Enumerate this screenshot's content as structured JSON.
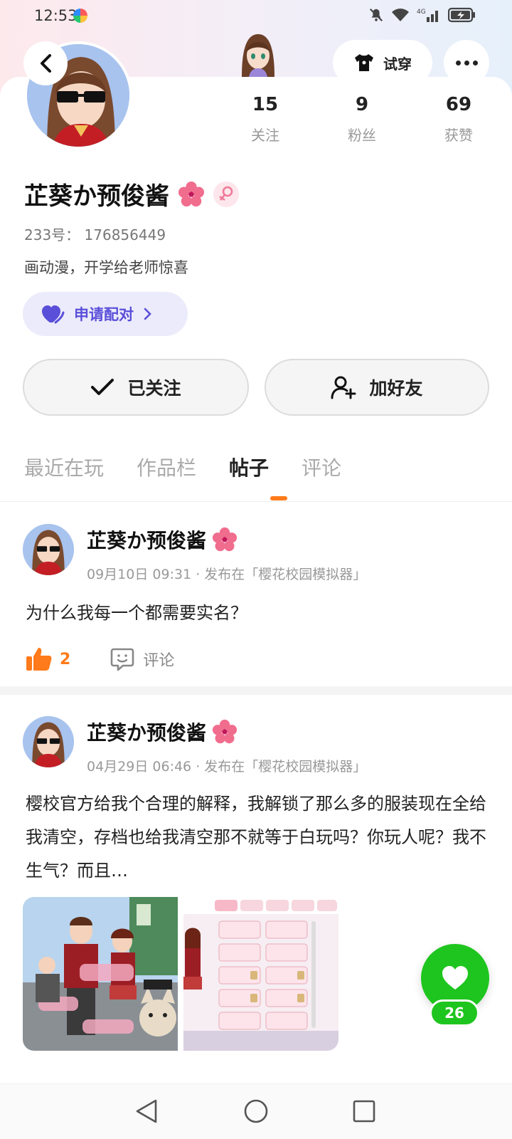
{
  "status_bar": {
    "time": "12:53",
    "icons": [
      "mute-icon",
      "wifi-icon",
      "4g-signal-icon",
      "battery-charging-icon"
    ],
    "network_label": "4G"
  },
  "header": {
    "try_on_label": "试穿",
    "more_icon": "more-dots-icon",
    "back_icon": "back-arrow-icon"
  },
  "profile": {
    "name": "芷葵か预俊酱",
    "id_line": "233号：  176856449",
    "bio": "画动漫，开学给老师惊喜",
    "pair_label": "申请配对",
    "stats": [
      {
        "num": "15",
        "label": "关注"
      },
      {
        "num": "9",
        "label": "粉丝"
      },
      {
        "num": "69",
        "label": "获赞"
      }
    ],
    "follow_label": "已关注",
    "add_friend_label": "加好友"
  },
  "tabs": [
    {
      "label": "最近在玩",
      "active": false
    },
    {
      "label": "作品栏",
      "active": false
    },
    {
      "label": "帖子",
      "active": true
    },
    {
      "label": "评论",
      "active": false
    }
  ],
  "posts": [
    {
      "author": "芷葵か预俊酱",
      "meta": "09月10日  09:31 · 发布在「樱花校园模拟器」",
      "text": "为什么我每一个都需要实名？",
      "likes": "2",
      "comment_label": "评论"
    },
    {
      "author": "芷葵か预俊酱",
      "meta": "04月29日  06:46 · 发布在「樱花校园模拟器」",
      "text": "樱校官方给我个合理的解释，我解锁了那么多的服装现在全给我清空，存档也给我清空那不就等于白玩吗？你玩人呢？我不生气？而且…"
    }
  ],
  "floating_like": {
    "count": "26"
  },
  "colors": {
    "accent_orange": "#ff7a1a",
    "pair_purple": "#5a4fd9",
    "like_green": "#1ec51e"
  }
}
